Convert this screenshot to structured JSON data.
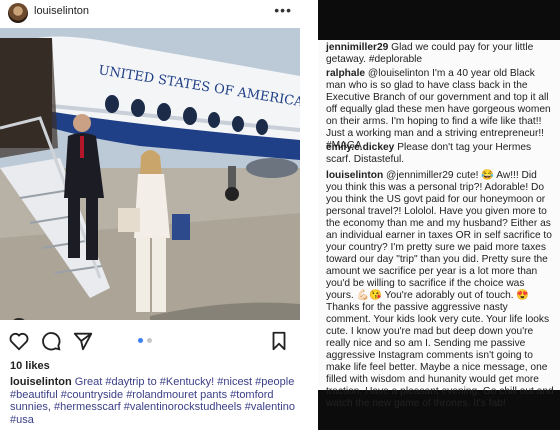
{
  "post": {
    "username": "louiselinton",
    "likes": "10 likes",
    "caption_user": "louiselinton",
    "caption_text": "Great #daytrip to #Kentucky! #nicest #people #beautiful #countryside #rolandmouret pants #tomford sunnies, #hermesscarf #valentinorockstudheels #valentino #usa",
    "plane_text": "UNITED STATES OF AMERICA",
    "icons": {
      "more": "more-options-icon",
      "like": "heart-icon",
      "comment": "comment-icon",
      "share": "share-icon",
      "save": "bookmark-icon",
      "tag": "user-tag-icon"
    }
  },
  "comments": [
    {
      "user": "jennimiller29",
      "text": "Glad we could pay for your little getaway. #deplorable"
    },
    {
      "user": "ralphale",
      "text": "@louiselinton I'm a 40 year old Black man who is so glad to have class back in the Executive Branch of our government and top it all off equally glad these men have gorgeous women on their arms. I'm hoping to find a wife like that!! Just a working man and a striving entrepreneur!! #MAGA"
    },
    {
      "user": "emily.e.dickey",
      "text": "Please don't tag your Hermes scarf. Distasteful."
    },
    {
      "user": "louiselinton",
      "text": "@jennimiller29 cute! 😂 Aw!!! Did you think this was a personal trip?! Adorable! Do you think the US govt paid for our honeymoon or personal travel?! Lololol. Have you given more to the economy than me and my husband? Either as an individual earner in taxes OR in self sacrifice to your country? I'm pretty sure we paid more taxes toward our day \"trip\" than you did. Pretty sure the amount we sacrifice per year is a lot more than you'd be willing to sacrifice if the choice was yours. 💪🏻😘 You're adorably out of touch. 😍 Thanks for the passive aggressive nasty comment. Your kids look very cute. Your life looks cute. I know you're mad but deep down you're really nice and so am I. Sending me passive aggressive Instagram comments isn't going to make life feel better. Maybe a nice message, one filled with wisdom and hunanity would get more traction. Have a pleasant evening. Go chill out and watch the new game of thrones. It's fab!"
    }
  ],
  "colors": {
    "hashtag": "#3b3f86",
    "plane_blue": "#1f3f86",
    "dark_band": "#0c0c0c"
  }
}
